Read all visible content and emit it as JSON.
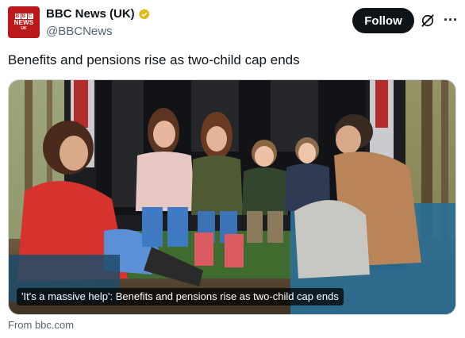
{
  "author": {
    "display_name": "BBC News (UK)",
    "handle": "@BBCNews",
    "verified": true,
    "verified_color": "#e2b719",
    "avatar_text": {
      "letters": [
        "B",
        "B",
        "C"
      ],
      "line2": "NEWS",
      "line3": "UK"
    },
    "avatar_color": "#bb1919"
  },
  "actions": {
    "follow_label": "Follow",
    "grok_icon": "grok-slash-icon",
    "more_icon": "more-horizontal-icon"
  },
  "tweet": {
    "text": "Benefits and pensions rise as two-child cap ends"
  },
  "card": {
    "caption": "'It's a massive help': Benefits and pensions rise as two-child cap ends",
    "source": "From bbc.com",
    "image_description_icon": "family-at-van-photo"
  }
}
